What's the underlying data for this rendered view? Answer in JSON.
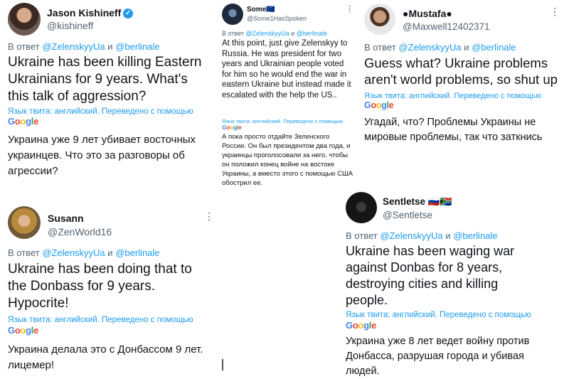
{
  "colors": {
    "link": "#1d9bf0",
    "muted": "#536471",
    "text": "#0f1419"
  },
  "common": {
    "reply_prefix": "В ответ",
    "mention1": "@ZelenskyyUa",
    "conj": "и",
    "mention2": "@berlinale",
    "translated_label": "Язык твита: английский. Переведено с помощью",
    "google": [
      "G",
      "o",
      "o",
      "g",
      "l",
      "e"
    ],
    "more": "⋮"
  },
  "tweets": [
    {
      "name": "Jason Kishineff",
      "handle": "@kishineff",
      "verified": "✓",
      "text": "Ukraine has been killing Eastern Ukrainians for 9 years. What's this talk of aggression?",
      "translation": "Украина уже 9 лет убивает восточных украинцев. Что это за разговоры об агрессии?"
    },
    {
      "name": "Some🇪🇺",
      "handle": "@Some1HasSpoken",
      "text": "At this point, just give Zelenskyy to Russia. He was president for two years and Ukrainian people voted for him so he would end the war in eastern Ukraine but instead made it escalated with the help the US..",
      "translation": "А пока просто отдайте Зеленского России. Он был президентом два года, и украинцы проголосовали за него, чтобы он положил конец войне на востоке Украины, а вместо этого с помощью США обострил ее."
    },
    {
      "name": "●Mustafa●",
      "handle": "@Maxwell12402371",
      "text": "Guess what? Ukraine problems aren't world problems, so shut up",
      "translation": "Угадай, что? Проблемы Украины не мировые проблемы, так что заткнись"
    },
    {
      "name": "Susann",
      "handle": "@ZenWorld16",
      "text": "Ukraine has been doing that to the Donbass for 9 years. Hypocrite!",
      "translation": "Украина делала это с Донбассом 9 лет. лицемер!"
    },
    {
      "name": "Sentletse 🇷🇺🇿🇦",
      "handle": "@Sentletse",
      "text": "Ukraine has been waging war against Donbas for 8 years, destroying cities and killing people.",
      "translation": "Украина уже 8 лет ведет войну против Донбасса, разрушая города и убивая людей."
    }
  ]
}
